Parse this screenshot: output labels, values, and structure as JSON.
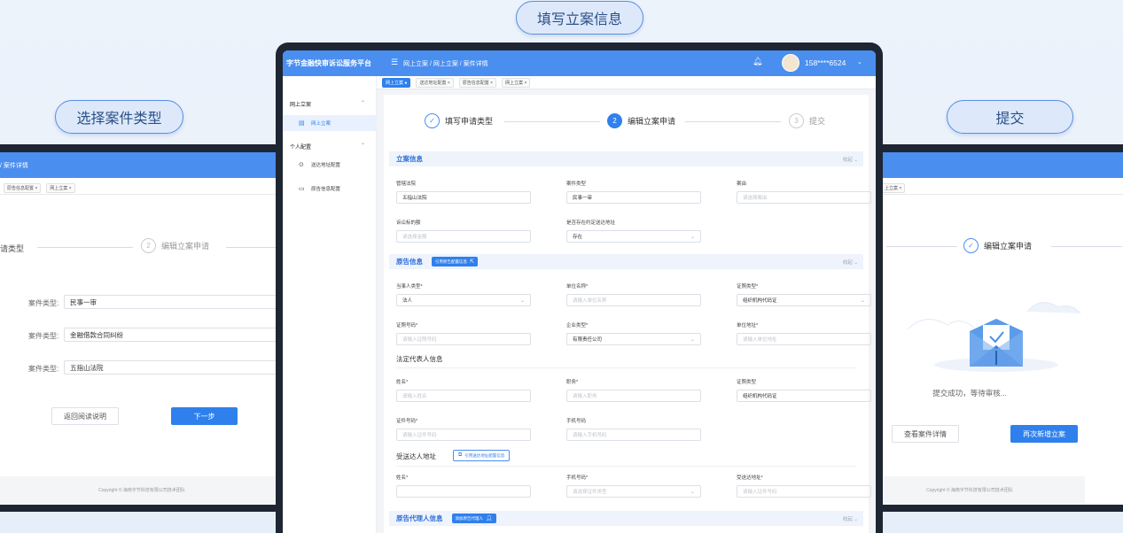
{
  "labels": {
    "left": "选择案件类型",
    "center": "填写立案信息",
    "right": "提交"
  },
  "app": {
    "brand": "字节金融快审诉讼服务平台",
    "breadcrumb": "网上立案 / 网上立案 / 案件详情",
    "user": "158****6524"
  },
  "left_screen": {
    "breadcrumb": "/ 案件详情",
    "tabs": [
      "原告信息配置",
      "网上立案"
    ],
    "step1_partial": "请类型",
    "step2_num": "2",
    "step2": "编辑立案申请",
    "fields": [
      {
        "label": "案件类型:",
        "value": "民事一审"
      },
      {
        "label": "案件类型:",
        "value": "金融借款合同纠纷"
      },
      {
        "label": "案件类型:",
        "value": "五指山法院"
      }
    ],
    "btn_back": "返回阅读说明",
    "btn_next": "下一步",
    "copyright": "Copyright © 海南字节科技有限公司技术团队"
  },
  "center_screen": {
    "tabs": [
      "网上立案",
      "送达地址配置",
      "原告信息配置",
      "网上立案"
    ],
    "sidebar": {
      "group1": "网上立案",
      "item1": "网上立案",
      "group2": "个人配置",
      "item2": "送达地址配置",
      "item3": "原告信息配置"
    },
    "steps": {
      "s1": "填写申请类型",
      "s2_num": "2",
      "s2": "编辑立案申请",
      "s3_num": "3",
      "s3": "提交"
    },
    "collapse": "收起",
    "sec1": {
      "title": "立案信息",
      "f1_label": "管辖法院",
      "f1_value": "五指山法院",
      "f2_label": "案件类型",
      "f2_value": "民事一审",
      "f3_label": "案由",
      "f3_ph": "请选择案由",
      "f4_label": "诉讼标的额",
      "f4_ph": "请选择金额",
      "f5_label": "是否存在约定送达地址",
      "f5_value": "存在"
    },
    "sec2": {
      "title": "原告信息",
      "btn": "引用原告配置信息",
      "f1_label": "当事人类型*",
      "f1_value": "法人",
      "f2_label": "单位名称*",
      "f2_ph": "请输入单位名称",
      "f3_label": "证照类型*",
      "f3_value": "组织机构代码证",
      "f4_label": "证照号码*",
      "f4_ph": "请输入证照号码",
      "f5_label": "企业类型*",
      "f5_value": "有限责任公司",
      "f6_label": "单位地址*",
      "f6_ph": "请输入单位地址",
      "legal_title": "法定代表人信息",
      "f7_label": "姓名*",
      "f7_ph": "请输入姓名",
      "f8_label": "职务*",
      "f8_ph": "请输入职务",
      "f9_label": "证照类型",
      "f9_value": "组织机构代码证",
      "f10_label": "证件号码*",
      "f10_ph": "请输入证件号码",
      "f11_label": "手机号码",
      "f11_ph": "请输入手机号码",
      "recv_title": "受送达人地址",
      "recv_btn": "引用送达地址配置信息",
      "f12_label": "姓名*",
      "f13_label": "手机号码*",
      "f13_ph": "请选择证件类型",
      "f14_label": "受送达地址*",
      "f14_ph": "请输入证件号码"
    },
    "sec3": {
      "title": "原告代理人信息",
      "btn": "添加原告代理人"
    }
  },
  "right_screen": {
    "tab": "上立案",
    "step_done": "编辑立案申请",
    "success": "提交成功，等待审核...",
    "btn_view": "查看案件详情",
    "btn_new": "再次新增立案",
    "copyright": "Copyright © 海南字节科技有限公司技术团队"
  }
}
